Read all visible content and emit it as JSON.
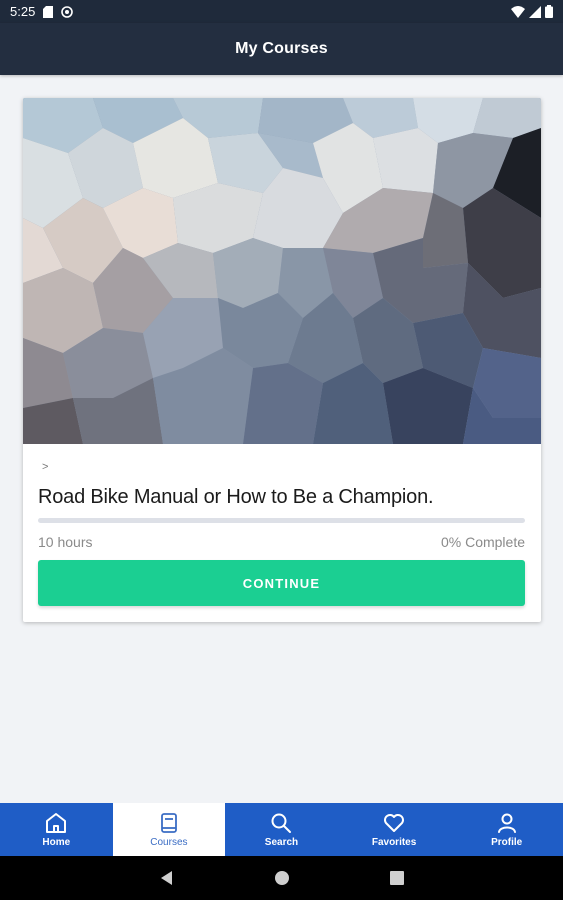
{
  "status_bar": {
    "time": "5:25"
  },
  "app_bar": {
    "title": "My Courses"
  },
  "course": {
    "breadcrumb": ">",
    "title": "Road Bike Manual or How to Be a Champion.",
    "duration": "10 hours",
    "progress_text": "0% Complete",
    "progress_fraction": 0,
    "button_label": "CONTINUE"
  },
  "bottom_nav": {
    "items": [
      {
        "label": "Home",
        "icon": "home-icon",
        "active": false
      },
      {
        "label": "Courses",
        "icon": "book-icon",
        "active": true
      },
      {
        "label": "Search",
        "icon": "search-icon",
        "active": false
      },
      {
        "label": "Favorites",
        "icon": "heart-icon",
        "active": false
      },
      {
        "label": "Profile",
        "icon": "person-icon",
        "active": false
      }
    ]
  },
  "colors": {
    "app_bar": "#232e40",
    "accent": "#1bcf92",
    "nav_bg": "#1f5dc6",
    "nav_active_text": "#3b6dc4"
  }
}
